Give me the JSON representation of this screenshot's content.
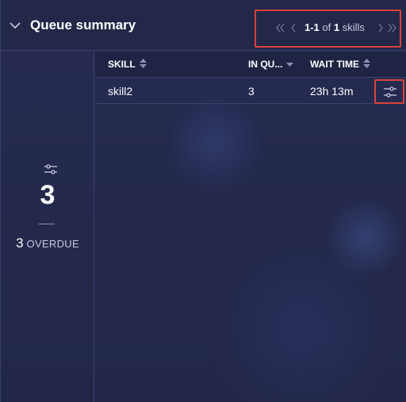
{
  "header": {
    "title": "Queue summary",
    "pager": {
      "range": "1-1",
      "of_word": "of",
      "total": "1",
      "unit": "skills"
    }
  },
  "summary": {
    "count": "3",
    "overdue_count": "3",
    "overdue_label": "OVERDUE"
  },
  "table": {
    "columns": [
      "SKILL",
      "IN QU...",
      "WAIT TIME"
    ],
    "rows": [
      {
        "skill": "skill2",
        "in_queue": "3",
        "wait_time": "23h 13m"
      }
    ]
  },
  "colors": {
    "background": "#252a50",
    "highlight": "#d9433b",
    "text": "#ffffff",
    "muted": "#c9cbe0"
  },
  "icons": [
    "chevron-down-icon",
    "double-chevron-left-icon",
    "chevron-left-icon",
    "chevron-right-icon",
    "double-chevron-right-icon",
    "filter-sliders-icon",
    "sort-icon",
    "sort-desc-icon"
  ]
}
